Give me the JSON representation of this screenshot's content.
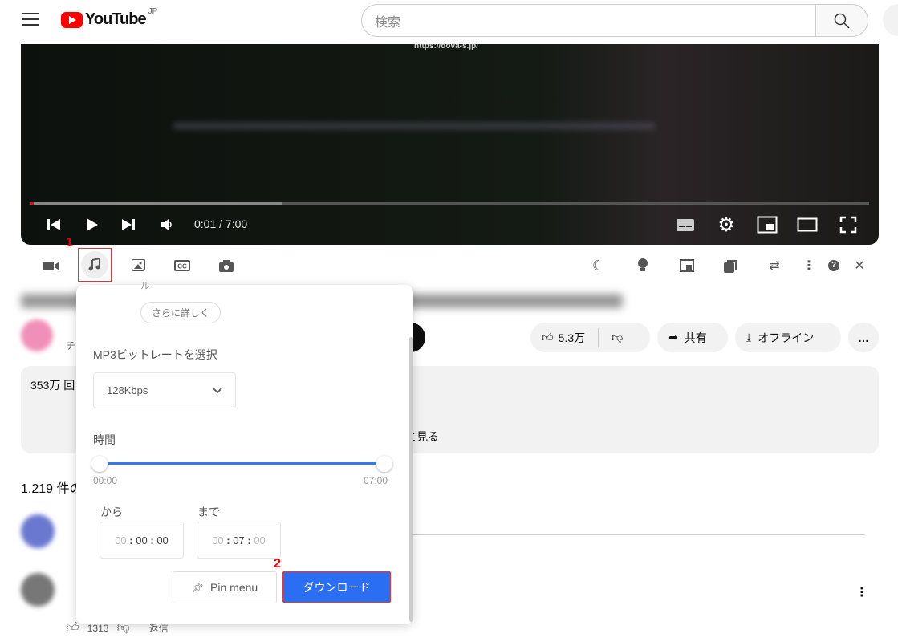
{
  "header": {
    "logo_text": "YouTube",
    "region": "JP",
    "search_placeholder": "検索"
  },
  "player": {
    "watermark": "https://dova-s.jp/",
    "time": "0:01 / 7:00",
    "progress_fraction": 0.0024,
    "buffered_fraction": 0.3
  },
  "extension_toolbar": {
    "left_icons": [
      "video-icon",
      "music-icon",
      "image-icon",
      "cc-icon",
      "camera-icon"
    ],
    "right_icons": [
      "moon-icon",
      "bulb-icon",
      "pip-icon",
      "stack-icon",
      "repeat-icon",
      "more-vert-icon",
      "help-icon",
      "close-icon"
    ],
    "step1_badge": "1"
  },
  "actions": {
    "like_count": "5.3万",
    "share": "共有",
    "offline": "オフライン",
    "more": "…"
  },
  "channel": {
    "subscribers_prefix": "チ"
  },
  "description": {
    "views_prefix": "353万 回",
    "show_more_suffix": "っと見る"
  },
  "comments": {
    "count_prefix": "1,219 件の",
    "like_count": "1313",
    "reply": "返信"
  },
  "popup": {
    "partial_text": "ル",
    "more_button": "さらに詳しく",
    "bitrate_label": "MP3ビットレートを選択",
    "bitrate_value": "128Kbps",
    "duration_label": "時間",
    "range_start": "00:00",
    "range_end": "07:00",
    "range_start_fraction": 0,
    "range_end_fraction": 1,
    "from_label": "から",
    "to_label": "まで",
    "from": {
      "h": "00",
      "m": "00",
      "s": "00"
    },
    "to": {
      "h": "00",
      "m": "07",
      "s": "00"
    },
    "pin_button": "Pin menu",
    "download_button": "ダウンロード",
    "step2_badge": "2",
    "accent": "#2a6ff3"
  }
}
